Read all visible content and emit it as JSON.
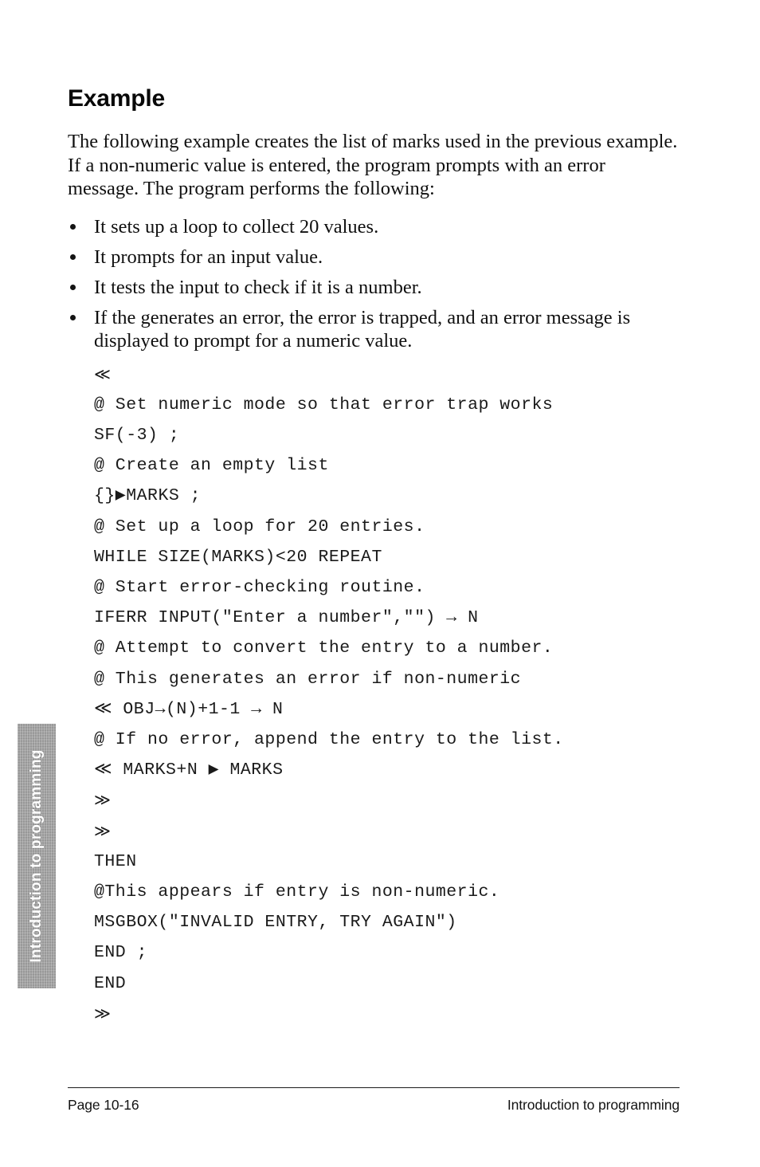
{
  "document": {
    "title": "Introduction to programming",
    "page_label": "Page 10-16"
  },
  "side_tab": {
    "label": "Introduction to programming"
  },
  "main": {
    "heading": "Example",
    "intro": "The following example creates the list of marks used in the previous example. If a non-numeric value is entered, the program prompts with an error message. The program performs the following:",
    "bullets": [
      "It sets up a loop to collect 20 values.",
      "It prompts for an input value.",
      "It tests the input to check if it is a number.",
      "If the generates an error, the error is trapped, and an error message is displayed to prompt for a numeric value."
    ],
    "code_lines": [
      "≪",
      "@ Set numeric mode so that error trap works",
      "SF(-3) ;",
      "@ Create an empty list",
      "{}▶MARKS ;",
      "@ Set up a loop for 20 entries.",
      "WHILE SIZE(MARKS)<20 REPEAT",
      "@ Start error-checking routine.",
      "IFERR INPUT(\"Enter a number\",\"\") → N",
      "@ Attempt to convert the entry to a number.",
      "@ This generates an error if non-numeric",
      "≪ OBJ→(N)+1-1 → N",
      "@ If no error, append the entry to the list.",
      "≪ MARKS+N ▶ MARKS",
      "≫",
      "≫",
      "THEN",
      "@This appears if entry is non-numeric.",
      "MSGBOX(\"INVALID ENTRY, TRY AGAIN\")",
      "END ;",
      "END",
      "≫"
    ]
  },
  "footer": {
    "page_label": "Page 10-16",
    "section_label": "Introduction to programming"
  },
  "colors": {
    "text": "#0d0d0d",
    "tab_background": "#8c8c8c",
    "tab_text": "#ffffff",
    "rule": "#1b1b1b",
    "page_background": "#ffffff"
  }
}
